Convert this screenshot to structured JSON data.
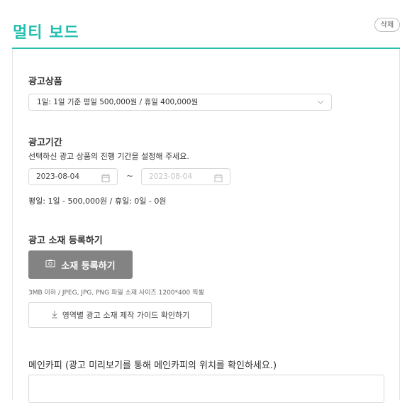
{
  "header": {
    "title": "멀티 보드",
    "delete_label": "삭제"
  },
  "ad_product": {
    "label": "광고상품",
    "selected": "1일: 1일 기준 평일 500,000원 / 휴일 400,000원",
    "chevron_icon": "chevron-down-icon"
  },
  "ad_period": {
    "label": "광고기간",
    "description": "선택하신 광고 상품의 진행 기간을 설정해 주세요.",
    "start_date": "2023-08-04",
    "end_date": "2023-08-04",
    "separator": "~",
    "calendar_icon": "calendar-icon",
    "summary": "평일: 1일 - 500,000원 / 휴일: 0일 - 0원"
  },
  "creative": {
    "label": "광고 소재 등록하기",
    "upload_button": "소재 등록하기",
    "upload_icon": "camera-icon",
    "file_hint": "3MB 이하 / JPEG, JPG, PNG 파일 소재 사이즈 1200*400 픽셀",
    "guide_button": "영역별 광고 소재 제작 가이드 확인하기",
    "guide_icon": "download-icon"
  },
  "main_copy": {
    "label": "메인카피 (광고 미리보기를 통해 메인카피의 위치를 확인하세요.)",
    "value": ""
  },
  "colors": {
    "accent": "#1fbfae",
    "upload_button_bg": "#838383",
    "disabled_text": "#c4c4c4"
  }
}
